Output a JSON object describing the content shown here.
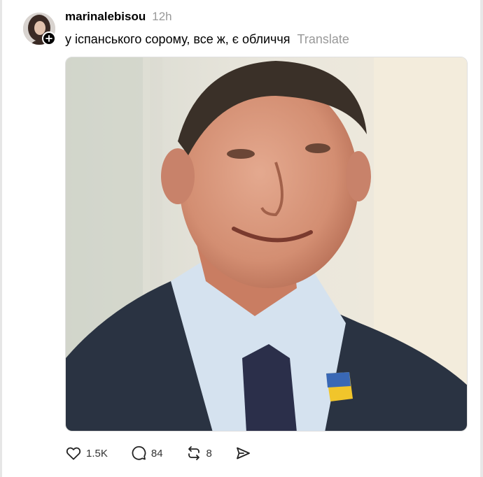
{
  "post": {
    "username": "marinalebisou",
    "timestamp": "12h",
    "caption": "у іспанського сорому, все ж, є обличчя",
    "translate_label": "Translate"
  },
  "actions": {
    "likes": "1.5K",
    "replies": "84",
    "reposts": "8"
  },
  "colors": {
    "muted_text": "#999999",
    "primary_text": "#000000"
  },
  "icons": [
    "plus-icon",
    "heart-icon",
    "comment-icon",
    "repost-icon",
    "share-icon"
  ]
}
